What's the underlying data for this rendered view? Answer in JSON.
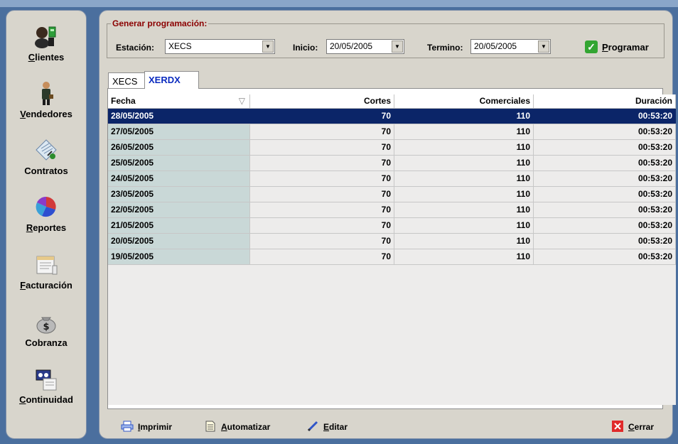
{
  "nav": {
    "items": [
      {
        "ul": "C",
        "rest": "lientes",
        "icon": "clients-icon"
      },
      {
        "ul": "V",
        "rest": "endedores",
        "icon": "salesman-icon"
      },
      {
        "ul": "",
        "rest": "Contratos",
        "icon": "contracts-icon"
      },
      {
        "ul": "R",
        "rest": "eportes",
        "icon": "reports-icon"
      },
      {
        "ul": "F",
        "rest": "acturación",
        "icon": "billing-icon"
      },
      {
        "ul": "",
        "rest": "Cobranza",
        "icon": "money-bag-icon"
      },
      {
        "ul": "C",
        "rest": "ontinuidad",
        "icon": "continuity-icon"
      }
    ]
  },
  "generar": {
    "legend": "Generar programación:",
    "estacion_label": "Estación:",
    "estacion_value": "XECS",
    "inicio_label": "Inicio:",
    "inicio_value": "20/05/2005",
    "termino_label": "Termino:",
    "termino_value": "20/05/2005",
    "programar_ul": "P",
    "programar_rest": "rogramar"
  },
  "tabs": [
    {
      "label": "XECS",
      "active": false
    },
    {
      "label": "XERDX",
      "active": true
    }
  ],
  "grid": {
    "headers": [
      "Fecha",
      "Cortes",
      "Comerciales",
      "Duración"
    ],
    "rows": [
      [
        "28/05/2005",
        "70",
        "110",
        "00:53:20"
      ],
      [
        "27/05/2005",
        "70",
        "110",
        "00:53:20"
      ],
      [
        "26/05/2005",
        "70",
        "110",
        "00:53:20"
      ],
      [
        "25/05/2005",
        "70",
        "110",
        "00:53:20"
      ],
      [
        "24/05/2005",
        "70",
        "110",
        "00:53:20"
      ],
      [
        "23/05/2005",
        "70",
        "110",
        "00:53:20"
      ],
      [
        "22/05/2005",
        "70",
        "110",
        "00:53:20"
      ],
      [
        "21/05/2005",
        "70",
        "110",
        "00:53:20"
      ],
      [
        "20/05/2005",
        "70",
        "110",
        "00:53:20"
      ],
      [
        "19/05/2005",
        "70",
        "110",
        "00:53:20"
      ]
    ],
    "selected_row": 0
  },
  "footer": {
    "imprimir_ul": "I",
    "imprimir_rest": "mprimir",
    "automatizar_ul": "A",
    "automatizar_rest": "utomatizar",
    "editar_ul": "E",
    "editar_rest": "ditar",
    "cerrar_ul": "C",
    "cerrar_rest": "errar"
  },
  "colors": {
    "background": "#4b6f9e",
    "panel": "#d8d5cc",
    "selection": "#0b2568",
    "fecha_column": "#c9d8d7",
    "legend": "#8b0000",
    "active_tab": "#0b2bbf"
  }
}
